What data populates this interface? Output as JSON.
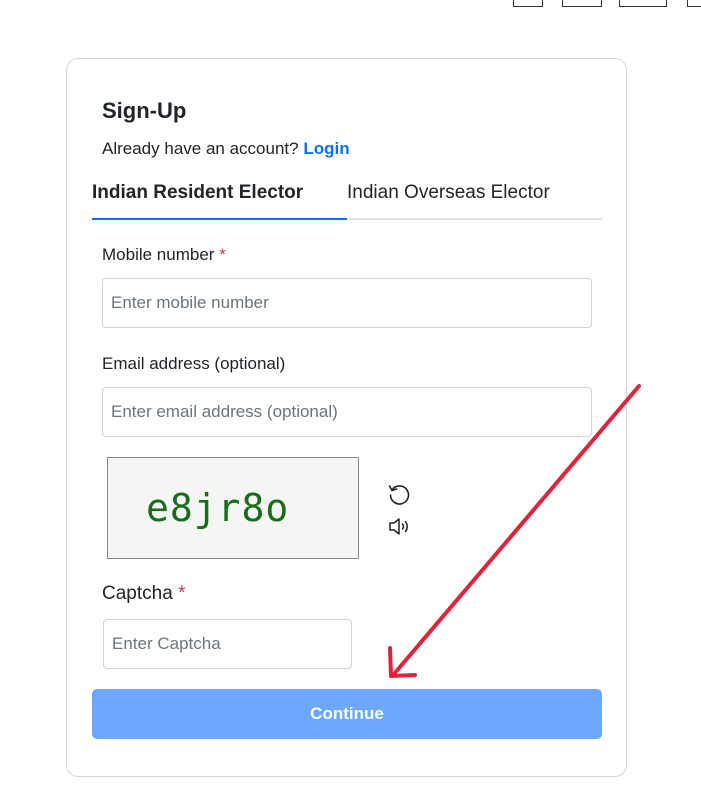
{
  "form": {
    "title": "Sign-Up",
    "account_prompt": "Already have an account?",
    "login_link": "Login",
    "tabs": [
      {
        "label": "Indian Resident Elector",
        "active": true
      },
      {
        "label": "Indian Overseas Elector",
        "active": false
      }
    ],
    "mobile": {
      "label": "Mobile number",
      "required_mark": "*",
      "placeholder": "Enter mobile number",
      "value": ""
    },
    "email": {
      "label": "Email address (optional)",
      "placeholder": "Enter email address (optional)",
      "value": ""
    },
    "captcha_image_text": "e8jr8o",
    "captcha": {
      "label": "Captcha",
      "required_mark": "*",
      "placeholder": "Enter Captcha",
      "value": ""
    },
    "continue_label": "Continue"
  },
  "icons": {
    "refresh": "refresh-icon",
    "audio": "speaker-icon"
  },
  "colors": {
    "link": "#0d6efd",
    "required": "#dc3545",
    "button": "#6ea8fe",
    "annotation_arrow": "#e0223a"
  }
}
